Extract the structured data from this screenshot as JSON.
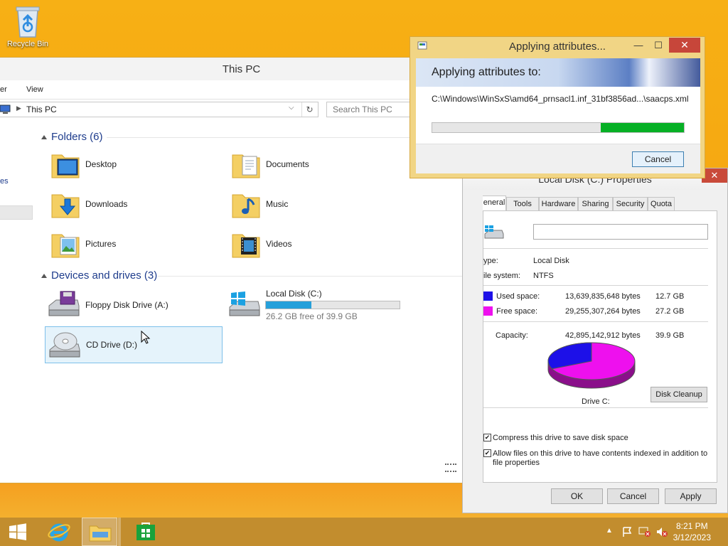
{
  "desktop": {
    "recycle_bin": "Recycle Bin"
  },
  "explorer": {
    "title": "This PC",
    "ribbon": {
      "partial_tab": "er",
      "view": "View"
    },
    "address": "This PC",
    "search_placeholder": "Search This PC",
    "nav_partial": "es",
    "folders_header": "Folders (6)",
    "folders": [
      {
        "name": "Desktop",
        "icon": "desktop-folder-icon"
      },
      {
        "name": "Documents",
        "icon": "documents-folder-icon"
      },
      {
        "name": "Downloads",
        "icon": "downloads-folder-icon"
      },
      {
        "name": "Music",
        "icon": "music-folder-icon"
      },
      {
        "name": "Pictures",
        "icon": "pictures-folder-icon"
      },
      {
        "name": "Videos",
        "icon": "videos-folder-icon"
      }
    ],
    "devices_header": "Devices and drives (3)",
    "drives": [
      {
        "name": "Floppy Disk Drive (A:)",
        "icon": "floppy-drive-icon"
      },
      {
        "name": "Local Disk (C:)",
        "free_text": "26.2 GB free of 39.9 GB",
        "used_fraction": 0.34,
        "icon": "local-disk-icon"
      },
      {
        "name": "CD Drive (D:)",
        "icon": "cd-drive-icon"
      }
    ]
  },
  "properties": {
    "title": "Local Disk (C:) Properties",
    "tabs": [
      "eneral",
      "Tools",
      "Hardware",
      "Sharing",
      "Security",
      "Quota"
    ],
    "type_label": "ype:",
    "type_value": "Local Disk",
    "fs_label": "ile system:",
    "fs_value": "NTFS",
    "used_label": "Used space:",
    "used_bytes": "13,639,835,648 bytes",
    "used_gb": "12.7 GB",
    "free_label": "Free space:",
    "free_bytes": "29,255,307,264 bytes",
    "free_gb": "27.2 GB",
    "capacity_label": "Capacity:",
    "capacity_bytes": "42,895,142,912 bytes",
    "capacity_gb": "39.9 GB",
    "drive_label": "Drive C:",
    "disk_cleanup": "Disk Cleanup",
    "compress_label": "Compress this drive to save disk space",
    "index_label_1": "Allow files on this drive to have contents indexed in addition to",
    "index_label_2": "file properties",
    "ok": "OK",
    "cancel": "Cancel",
    "apply": "Apply",
    "colors": {
      "used": "#1d10e8",
      "free": "#ee10ee"
    },
    "used_fraction": 0.318
  },
  "apply_dialog": {
    "title": "Applying attributes...",
    "heading": "Applying attributes to:",
    "path": "C:\\Windows\\WinSxS\\amd64_prnsacl1.inf_31bf3856ad...\\saacps.xml",
    "progress_from": 0.67,
    "progress_to": 1.0,
    "cancel": "Cancel",
    "minimize": "—",
    "maximize": "☐",
    "close": "✕"
  },
  "taskbar": {
    "time": "8:21 PM",
    "date": "3/12/2023"
  }
}
